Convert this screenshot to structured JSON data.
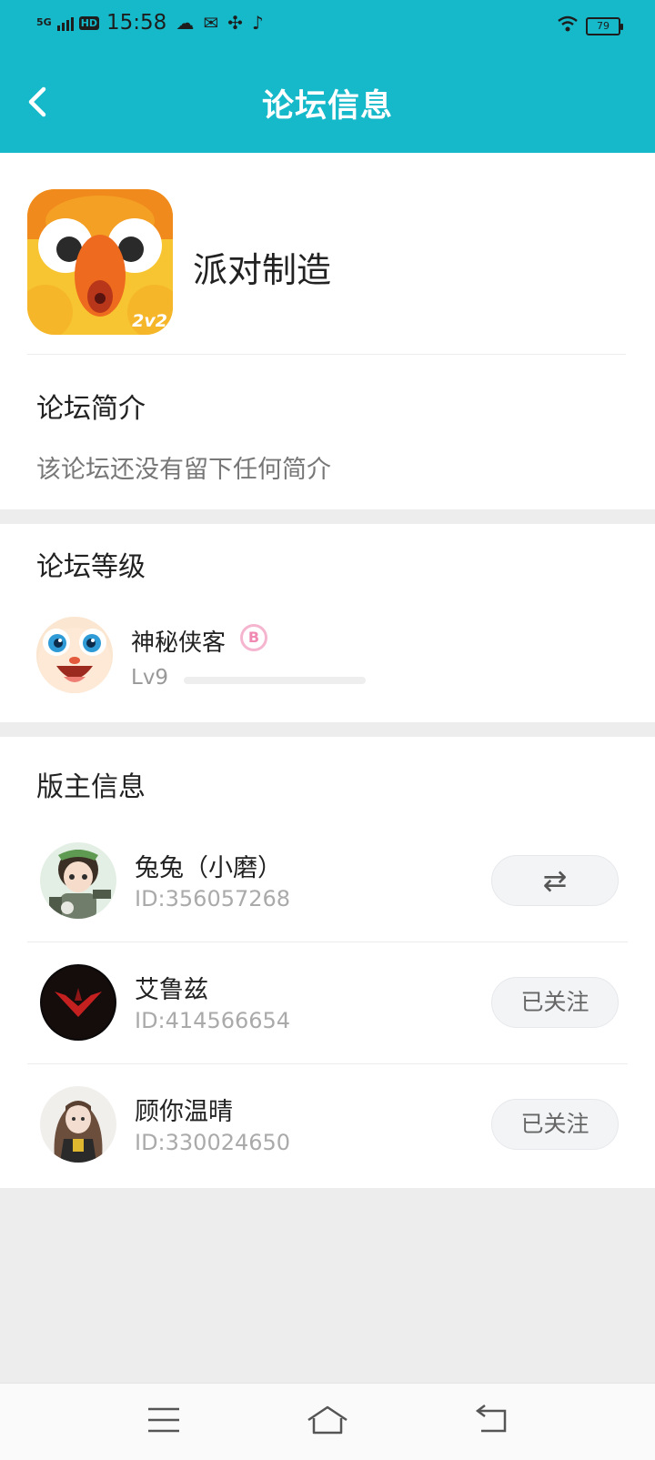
{
  "status": {
    "network": "5G",
    "hd": "HD",
    "time": "15:58",
    "battery": "79"
  },
  "header": {
    "title": "论坛信息"
  },
  "forum": {
    "name": "派对制造",
    "icon_badge": "2v2"
  },
  "intro": {
    "title": "论坛简介",
    "text": "该论坛还没有留下任何简介"
  },
  "level": {
    "title": "论坛等级",
    "user_name": "神秘侠客",
    "badge": "B",
    "level_text": "Lv9",
    "progress": 0
  },
  "moderators": {
    "title": "版主信息",
    "items": [
      {
        "name": "兔兔（小磨）",
        "id": "ID:356057268",
        "action": "⇄"
      },
      {
        "name": "艾鲁兹",
        "id": "ID:414566654",
        "action": "已关注"
      },
      {
        "name": "顾你温晴",
        "id": "ID:330024650",
        "action": "已关注"
      }
    ]
  },
  "colors": {
    "accent": "#16b9c9",
    "background": "#ededed"
  }
}
